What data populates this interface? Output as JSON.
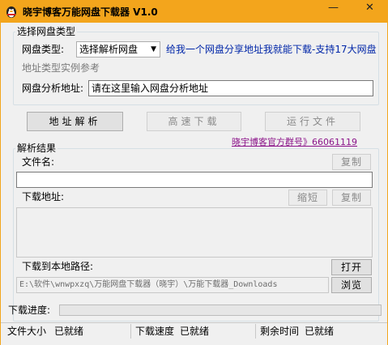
{
  "window": {
    "title": "晓宇博客万能网盘下载器 V1.0",
    "minimize_glyph": "—",
    "close_glyph": "✕"
  },
  "pan_group": {
    "legend": "选择网盘类型",
    "type_label": "网盘类型:",
    "type_selected": "选择解析网盘",
    "promo_link": "给我一个网盘分享地址我就能下载-支持17大网盘",
    "example_link": "地址类型实例参考",
    "url_label": "网盘分析地址:",
    "url_value": "请在这里输入网盘分析地址"
  },
  "actions": {
    "parse_button": "地址解析",
    "fast_download_button": "高速下载",
    "run_file_button": "运行文件",
    "qq_group_link": "晓宇博客官方群号》66061119"
  },
  "result_group": {
    "legend": "解析结果",
    "filename_label": "文件名:",
    "filename_copy": "复制",
    "filename_value": "",
    "download_url_label": "下载地址:",
    "shorten_button": "缩短",
    "url_copy": "复制",
    "download_url_value": ""
  },
  "local_path": {
    "label": "下载到本地路径:",
    "open_button": "打开",
    "path_value": "E:\\软件\\wnwpxzq\\万能网盘下载器（晓宇）\\万能下载器_Downloads",
    "browse_button": "浏览"
  },
  "progress": {
    "label": "下载进度:",
    "fraction": 0.0
  },
  "status": {
    "size_label": "文件大小",
    "size_value": "已就绪",
    "speed_label": "下载速度",
    "speed_value": "已就绪",
    "remaining_label": "剩余时间",
    "remaining_value": "已就绪"
  },
  "colors": {
    "titlebar": "#f3a51c",
    "link_blue": "#0026a8",
    "link_purple": "#8b1289"
  },
  "icons": {
    "app": "qq-penguin-icon"
  }
}
